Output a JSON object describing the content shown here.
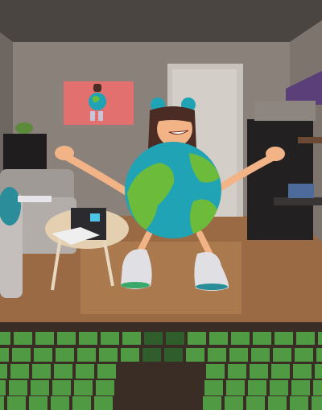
{
  "scene": {
    "colors": {
      "ceiling": "#4a4541",
      "back_wall": "#8a817b",
      "floor": "#9a6a45",
      "poster": "#e2706e",
      "door": "#cfc9c4",
      "globe_ocean": "#1fa3b5",
      "globe_land": "#6dbb3a",
      "skin": "#f2b486",
      "hair": "#4a2c25",
      "keyboard": "#4f9a43"
    }
  }
}
